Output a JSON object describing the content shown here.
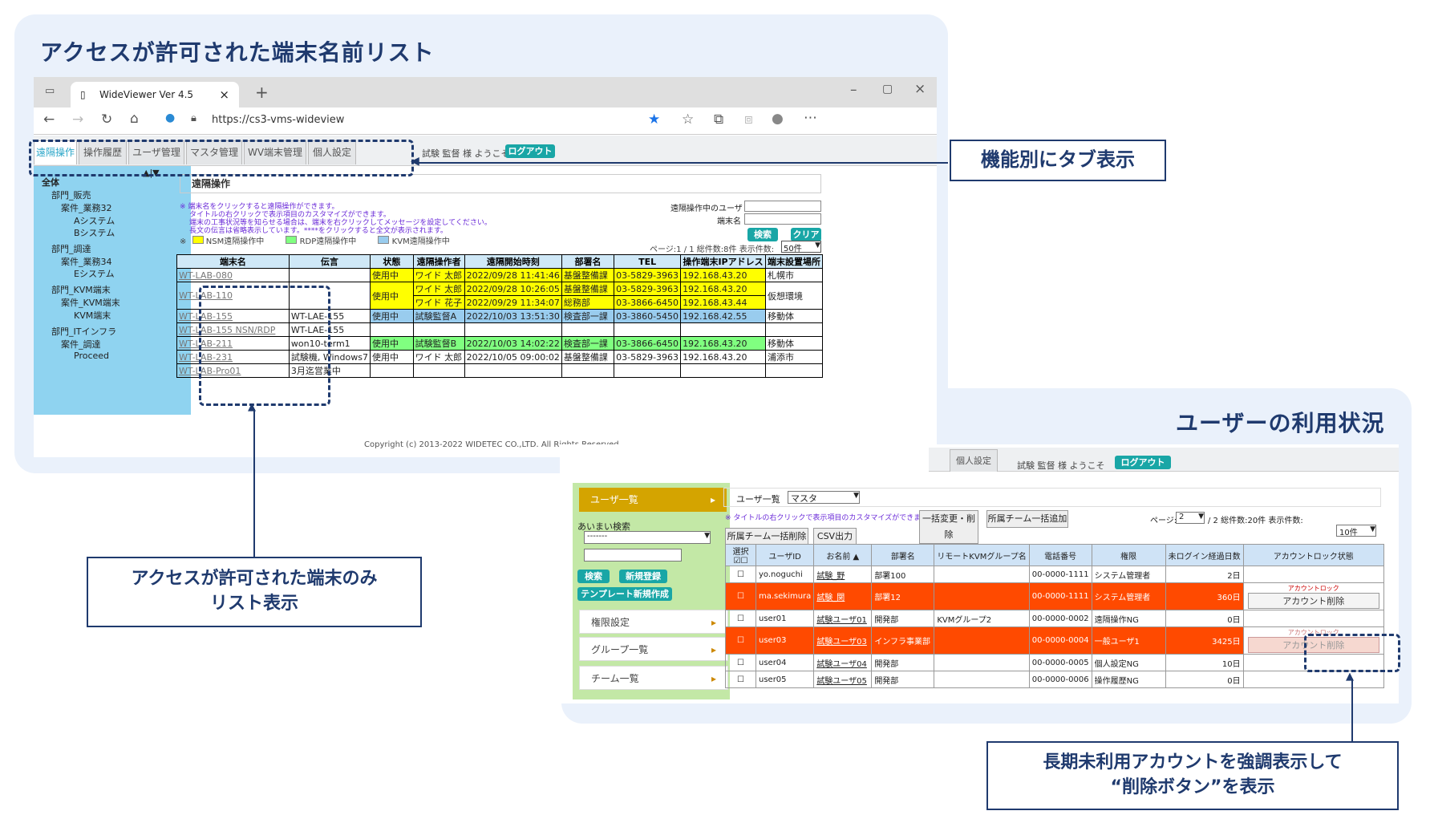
{
  "panel1": {
    "title": "アクセスが許可された端末名前リスト"
  },
  "panel2": {
    "title": "ユーザーの利用状況"
  },
  "callouts": {
    "tabs": "機能別にタブ表示",
    "terminals": "アクセスが許可された端末のみ\nリスト表示",
    "delete": "長期未利用アカウントを強調表示して\n“削除ボタン”を表示"
  },
  "browser": {
    "tab_title": "WideViewer Ver 4.5",
    "url": "https://cs3-vms-wideview"
  },
  "app": {
    "tabs": [
      "遠隔操作",
      "操作履歴",
      "ユーザ管理",
      "マスタ管理",
      "WV端末管理",
      "個人設定"
    ],
    "welcome": "試験 監督 様 ようこそ",
    "logout": "ログアウト",
    "page_heading": "遠隔操作",
    "notes": [
      "※ 端末名をクリックすると遠隔操作ができます。",
      "タイトルの右クリックで表示項目のカスタマイズができます。",
      "端末の工事状況等を知らせる場合は、端末を右クリックしてメッセージを設定してください。",
      "長文の伝言は省略表示しています。****をクリックすると全文が表示されます。"
    ],
    "legend": {
      "prefix": "※",
      "nsm": "NSM遠隔操作中",
      "rdp": "RDP遠隔操作中",
      "kvm": "KVM遠隔操作中"
    },
    "search": {
      "user_label": "遠隔操作中のユーザ",
      "terminal_label": "端末名",
      "search_btn": "検索",
      "clear_btn": "クリア"
    },
    "paging": {
      "text": "ページ:1 / 1  総件数:8件  表示件数:",
      "per_page": "50件"
    },
    "copyright": "Copyright (c) 2013-2022 WIDETEC CO.,LTD. All Rights Reserved",
    "tree": {
      "root": "全体",
      "nodes": [
        "部門_販売",
        "案件_業務32",
        "Aシステム",
        "Bシステム",
        "部門_調達",
        "案件_業務34",
        "Eシステム",
        "部門_KVM端末",
        "案件_KVM端末",
        "KVM端末",
        "部門_ITインフラ",
        "案件_調達",
        "Proceed"
      ]
    },
    "columns": [
      "端末名",
      "伝言",
      "状態",
      "遠隔操作者",
      "遠隔開始時刻",
      "部署名",
      "TEL",
      "操作端末IPアドレス",
      "端末設置場所"
    ],
    "rows": [
      [
        "WT-LAB-080",
        "",
        "使用中",
        "ワイド 太郎",
        "2022/09/28 11:41:46",
        "基盤整備課",
        "03-5829-3963",
        "192.168.43.20",
        "札幌市"
      ],
      [
        "WT-LAB-110",
        "",
        "使用中",
        "ワイド 太郎",
        "2022/09/28 10:26:05",
        "基盤整備課",
        "03-5829-3963",
        "192.168.43.20",
        "仮想環境"
      ],
      [
        "",
        "",
        "",
        "ワイド 花子",
        "2022/09/29 11:34:07",
        "総務部",
        "03-3866-6450",
        "192.168.43.44",
        ""
      ],
      [
        "WT-LAB-155",
        "WT-LAE-155",
        "使用中",
        "試験監督A",
        "2022/10/03 13:51:30",
        "検査部一課",
        "03-3860-5450",
        "192.168.42.55",
        "移動体"
      ],
      [
        "WT-LAB-155 NSN/RDP",
        "WT-LAE-155",
        "",
        "",
        "",
        "",
        "",
        "",
        ""
      ],
      [
        "WT-LAB-211",
        "won10-term1",
        "使用中",
        "試験監督B",
        "2022/10/03 14:02:22",
        "検査部一課",
        "03-3866-6450",
        "192.168.43.20",
        "移動体"
      ],
      [
        "WT-LAB-231",
        "試験機, Windows7",
        "使用中",
        "ワイド 太郎",
        "2022/10/05 09:00:02",
        "基盤整備課",
        "03-5829-3963",
        "192.168.43.20",
        "浦添市"
      ],
      [
        "WT-LAB-Pro01",
        "3月迄営業中",
        "",
        "",
        "",
        "",
        "",
        "",
        ""
      ]
    ]
  },
  "app2": {
    "tab": "個人設定",
    "welcome": "試験 監督 様 ようこそ",
    "logout": "ログアウト",
    "menu": [
      "ユーザ一覧",
      "権限設定",
      "グループ一覧",
      "チーム一覧"
    ],
    "fuzzy_label": "あいまい検索",
    "fuzzy_select": "-------",
    "btn_search": "検索",
    "btn_new": "新規登録",
    "btn_template": "テンプレート新規作成",
    "list_label": "ユーザ一覧",
    "list_select": "マスタ",
    "note": "※ タイトルの右クリックで表示項目のカスタマイズができます。",
    "btn_bulk": "一括変更・削除",
    "btn_team_add": "所属チーム一括追加",
    "btn_team_del": "所属チーム一括削除",
    "btn_csv": "CSV出力",
    "paging_label": "ページ:",
    "page": "2",
    "paging_rest": "/ 2  総件数:20件  表示件数:",
    "per_page": "10件",
    "columns": [
      "選択",
      "ユーザID",
      "お名前 ▲",
      "部署名",
      "リモートKVMグループ名",
      "電話番号",
      "権限",
      "未ログイン経過日数",
      "アカウントロック状態"
    ],
    "rows": [
      {
        "id": "yo.noguchi",
        "name": "試験_野",
        "dept": "部署100",
        "kvm": "",
        "tel": "00-0000-1111",
        "role": "システム管理者",
        "days": "2日",
        "lock": "",
        "btn": "",
        "red": false
      },
      {
        "id": "ma.sekimura",
        "name": "試験_関",
        "dept": "部署12",
        "kvm": "",
        "tel": "00-0000-1111",
        "role": "システム管理者",
        "days": "360日",
        "lock": "アカウントロック",
        "btn": "アカウント削除",
        "red": true
      },
      {
        "id": "user01",
        "name": "試験ユーザ01",
        "dept": "開発部",
        "kvm": "KVMグループ2",
        "tel": "00-0000-0002",
        "role": "遠隔操作NG",
        "days": "0日",
        "lock": "",
        "btn": "",
        "red": false
      },
      {
        "id": "user03",
        "name": "試験ユーザ03",
        "dept": "インフラ事業部",
        "kvm": "",
        "tel": "00-0000-0004",
        "role": "一般ユーザ1",
        "days": "3425日",
        "lock": "アカウントロック",
        "btn": "アカウント削除",
        "red": true
      },
      {
        "id": "user04",
        "name": "試験ユーザ04",
        "dept": "開発部",
        "kvm": "",
        "tel": "00-0000-0005",
        "role": "個人設定NG",
        "days": "10日",
        "lock": "",
        "btn": "",
        "red": false
      },
      {
        "id": "user05",
        "name": "試験ユーザ05",
        "dept": "開発部",
        "kvm": "",
        "tel": "00-0000-0006",
        "role": "操作履歴NG",
        "days": "0日",
        "lock": "",
        "btn": "",
        "red": false
      }
    ]
  }
}
